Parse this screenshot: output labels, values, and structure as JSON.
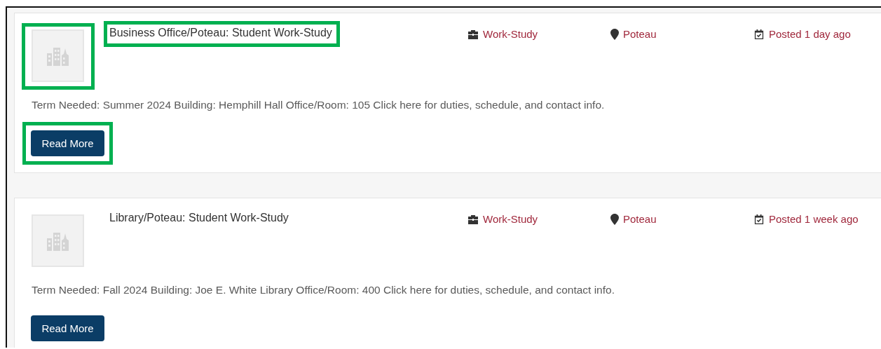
{
  "jobs": [
    {
      "logo_highlighted": true,
      "title": "Business Office/Poteau: Student Work-Study",
      "title_highlighted": true,
      "type": "Work-Study",
      "location": "Poteau",
      "posted": "Posted 1 day ago",
      "description": "Term Needed: Summer 2024 Building: Hemphill Hall Office/Room: 105 Click here for duties, schedule, and contact info.",
      "button": "Read More",
      "button_highlighted": true
    },
    {
      "logo_highlighted": false,
      "title": "Library/Poteau: Student Work-Study",
      "title_highlighted": false,
      "type": "Work-Study",
      "location": "Poteau",
      "posted": "Posted 1 week ago",
      "description": "Term Needed: Fall 2024 Building: Joe E. White Library Office/Room: 400 Click here for duties, schedule, and contact info.",
      "button": "Read More",
      "button_highlighted": false
    }
  ]
}
